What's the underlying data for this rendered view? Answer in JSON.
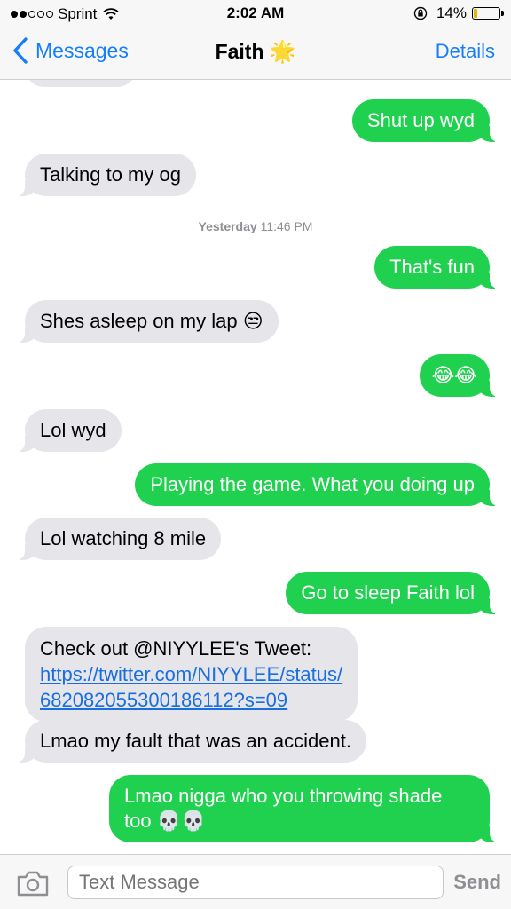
{
  "status_bar": {
    "carrier": "Sprint",
    "time": "2:02 AM",
    "battery_percent": "14%",
    "battery_level": 0.14
  },
  "nav": {
    "back_label": "Messages",
    "contact_name": "Faith",
    "contact_emoji": "🌟",
    "details_label": "Details"
  },
  "messages": [
    {
      "dir": "out",
      "text": "Shut up wyd"
    },
    {
      "dir": "in",
      "text": "Talking to my og"
    },
    {
      "dir": "out",
      "text": "That's fun"
    },
    {
      "dir": "in",
      "text": "Shes asleep on my lap",
      "emoji": "😒"
    },
    {
      "dir": "out",
      "text": "",
      "emoji": "😂😂"
    },
    {
      "dir": "in",
      "text": "Lol wyd"
    },
    {
      "dir": "out",
      "text": "Playing the game. What you doing up"
    },
    {
      "dir": "in",
      "text": "Lol watching 8 mile"
    },
    {
      "dir": "out",
      "text": "Go to sleep Faith lol"
    },
    {
      "dir": "in",
      "text": "Check out @NIYYLEE's Tweet:",
      "link_line1": "https://twitter.com/NIYYLEE/status/",
      "link_line2": "682082055300186112?s=09"
    },
    {
      "dir": "in",
      "text": "Lmao my fault that was an accident."
    },
    {
      "dir": "out",
      "text": "Lmao nigga who you throwing shade",
      "text_line2": "too",
      "emoji": "💀💀"
    }
  ],
  "timestamp": {
    "day": "Yesterday",
    "time": "11:46 PM"
  },
  "input": {
    "placeholder": "Text Message",
    "send_label": "Send"
  },
  "colors": {
    "ios_blue": "#157efb",
    "sms_green": "#1fd14e",
    "incoming_gray": "#e5e5ea",
    "battery_yellow": "#e2b300"
  }
}
